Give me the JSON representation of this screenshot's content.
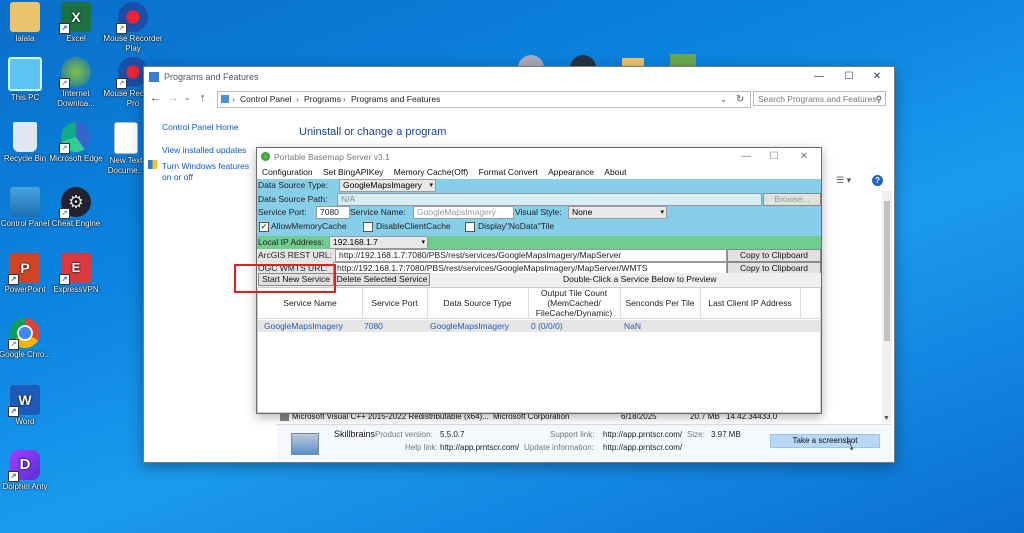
{
  "desktop": {
    "icons": [
      {
        "label": "lalala"
      },
      {
        "label": "Excel"
      },
      {
        "label": "Mouse Recorder Play"
      },
      {
        "label": "This PC"
      },
      {
        "label": "Internet Downloa..."
      },
      {
        "label": "Mouse Recorder Pro"
      },
      {
        "label": "Recycle Bin"
      },
      {
        "label": "Microsoft Edge"
      },
      {
        "label": "New Text Docume..."
      },
      {
        "label": "Control Panel"
      },
      {
        "label": "Cheat Engine"
      },
      {
        "label": "PowerPoint"
      },
      {
        "label": "ExpressVPN"
      },
      {
        "label": "Google Chro..."
      },
      {
        "label": "Word"
      },
      {
        "label": "Dolphin Anty"
      }
    ]
  },
  "programs_window": {
    "title": "Programs and Features",
    "breadcrumb": [
      "Control Panel",
      "Programs",
      "Programs and Features"
    ],
    "search_placeholder": "Search Programs and Features",
    "sidebar": {
      "home": "Control Panel Home",
      "updates": "View installed updates",
      "features": "Turn Windows features on or off"
    },
    "heading": "Uninstall or change a program",
    "list_row": {
      "name": "Microsoft Visual C++ 2015-2022 Redistributable (x64)...",
      "publisher": "Microsoft Corporation",
      "date": "6/18/2025",
      "size": "20.7 MB",
      "version": "14.42.34433.0"
    },
    "details": {
      "publisher": "Skillbrains",
      "product_version_label": "Product version:",
      "product_version": "5.5.0.7",
      "support_link_label": "Support link:",
      "support_link": "http://app.prntscr.com/",
      "size_label": "Size:",
      "size": "3.97 MB",
      "help_link_label": "Help link:",
      "help_link": "http://app.prntscr.com/",
      "update_info_label": "Update information:",
      "update_info": "http://app.prntscr.com/"
    },
    "take_screenshot": "Take a screenshot"
  },
  "basemap": {
    "title": "Portable Basemap Server v3.1",
    "menu": [
      "Configuration",
      "Set BingAPIKey",
      "Memory Cache(Off)",
      "Format Convert",
      "Appearance",
      "About"
    ],
    "data_source_type_label": "Data Source Type:",
    "data_source_type": "GoogleMapsImagery",
    "data_source_path_label": "Data Source Path:",
    "data_source_path": "N/A",
    "browse": "Browse...",
    "service_port_label": "Service Port:",
    "service_port": "7080",
    "service_name_label": "Service Name:",
    "service_name": "GoogleMapsImagery",
    "visual_style_label": "Visual Style:",
    "visual_style": "None",
    "allow_memory_cache": "AllowMemoryCache",
    "disable_client_cache": "DisableClientCache",
    "display_nodata": "Display\"NoData\"Tile",
    "local_ip_label": "Local IP Address:",
    "local_ip": "192.168.1.7",
    "arcgis_label": "ArcGIS REST URL:",
    "arcgis_url": "http://192.168.1.7:7080/PBS/rest/services/GoogleMapsImagery/MapServer",
    "ogc_label": "OGC WMTS URL:",
    "ogc_url": "http://192.168.1.7:7080/PBS/rest/services/GoogleMapsImagery/MapServer/WMTS",
    "copy": "Copy to Clipboard",
    "start_service": "Start New Service",
    "delete_service": "Delete Selected Service",
    "hint": "Double-Click a Service Below to Preview",
    "columns": [
      "Service Name",
      "Service Port",
      "Data Source Type",
      "Output Tile Count (MemCached/ FileCache/Dynamic)",
      "Senconds Per Tile",
      "Last Client IP Address"
    ],
    "rows": [
      [
        "GoogleMapsImagery",
        "7080",
        "GoogleMapsImagery",
        "0 (0/0/0)",
        "NaN",
        ""
      ]
    ]
  }
}
